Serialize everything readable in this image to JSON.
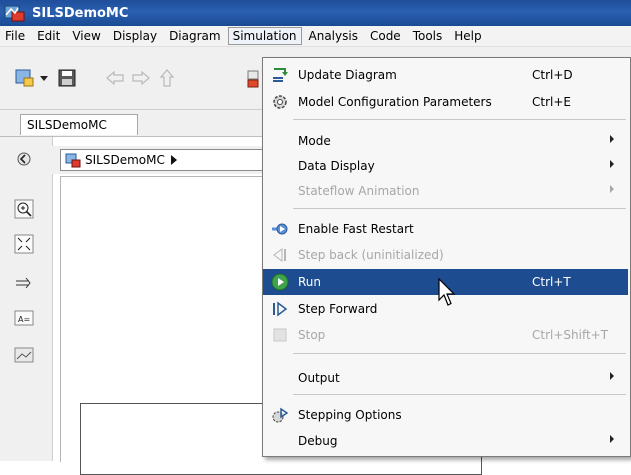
{
  "window": {
    "title": "SILSDemoMC"
  },
  "menubar": {
    "items": [
      {
        "label": "File"
      },
      {
        "label": "Edit"
      },
      {
        "label": "View"
      },
      {
        "label": "Display"
      },
      {
        "label": "Diagram"
      },
      {
        "label": "Simulation"
      },
      {
        "label": "Analysis"
      },
      {
        "label": "Code"
      },
      {
        "label": "Tools"
      },
      {
        "label": "Help"
      }
    ],
    "active_index": 5
  },
  "tabs": {
    "active_label": "SILSDemoMC"
  },
  "explorer": {
    "path_label": "SILSDemoMC"
  },
  "simulation_menu": {
    "items": [
      {
        "label": "Update Diagram",
        "shortcut": "Ctrl+D",
        "icon": "update-diagram-icon",
        "enabled": true
      },
      {
        "label": "Model Configuration Parameters",
        "shortcut": "Ctrl+E",
        "icon": "gear-icon",
        "enabled": true
      },
      {
        "label": "Mode",
        "submenu": true,
        "enabled": true
      },
      {
        "label": "Data Display",
        "submenu": true,
        "enabled": true
      },
      {
        "label": "Stateflow Animation",
        "submenu": true,
        "enabled": false
      },
      {
        "label": "Enable Fast Restart",
        "icon": "fast-restart-icon",
        "enabled": true
      },
      {
        "label": "Step back (uninitialized)",
        "icon": "step-back-icon",
        "enabled": false
      },
      {
        "label": "Run",
        "shortcut": "Ctrl+T",
        "icon": "run-icon",
        "enabled": true,
        "highlighted": true
      },
      {
        "label": "Step Forward",
        "icon": "step-forward-icon",
        "enabled": true
      },
      {
        "label": "Stop",
        "shortcut": "Ctrl+Shift+T",
        "icon": "stop-icon",
        "enabled": false
      },
      {
        "label": "Output",
        "submenu": true,
        "enabled": true
      },
      {
        "label": "Stepping Options",
        "icon": "stepping-options-icon",
        "enabled": true
      },
      {
        "label": "Debug",
        "submenu": true,
        "enabled": true
      }
    ]
  },
  "colors": {
    "highlight": "#1d4c91",
    "titlebar": "#2a5fb0",
    "disabled_text": "#a7a7a7"
  }
}
